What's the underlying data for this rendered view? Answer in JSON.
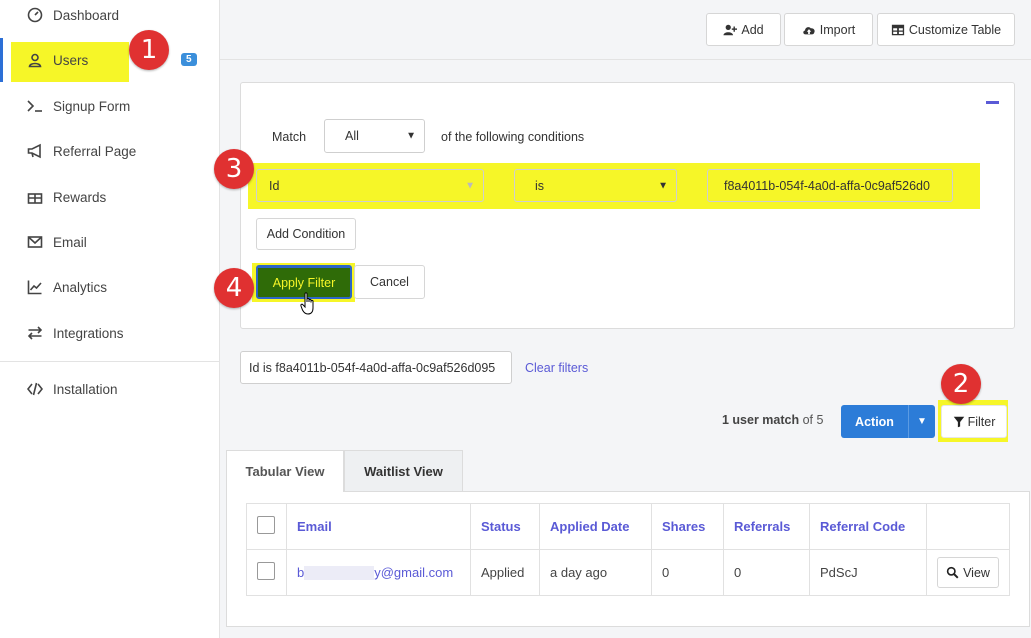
{
  "sidebar": {
    "items": [
      {
        "label": "Dashboard",
        "icon": "dashboard-icon"
      },
      {
        "label": "Users",
        "icon": "user-icon",
        "badge": "5"
      },
      {
        "label": "Signup Form",
        "icon": "terminal-icon"
      },
      {
        "label": "Referral Page",
        "icon": "megaphone-icon"
      },
      {
        "label": "Rewards",
        "icon": "gift-icon"
      },
      {
        "label": "Email",
        "icon": "envelope-icon"
      },
      {
        "label": "Analytics",
        "icon": "chart-line-icon"
      },
      {
        "label": "Integrations",
        "icon": "exchange-icon"
      },
      {
        "label": "Installation",
        "icon": "code-icon"
      }
    ]
  },
  "toolbar": {
    "add_label": "Add",
    "import_label": "Import",
    "customize_label": "Customize Table"
  },
  "filter_panel": {
    "match_label": "Match",
    "match_value": "All",
    "conditions_label": "of the following conditions",
    "field_value": "Id",
    "operator_value": "is",
    "condition_value": "f8a4011b-054f-4a0d-affa-0c9af526d0",
    "add_condition_label": "Add Condition",
    "apply_label": "Apply Filter",
    "cancel_label": "Cancel"
  },
  "active_filter": {
    "chip_text": "Id is f8a4011b-054f-4a0d-affa-0c9af526d095",
    "clear_label": "Clear filters"
  },
  "results": {
    "match_count": "1 user match",
    "match_suffix": " of 5",
    "action_label": "Action",
    "filter_label": "Filter"
  },
  "tabs": [
    {
      "label": "Tabular View"
    },
    {
      "label": "Waitlist View"
    }
  ],
  "table": {
    "headers": [
      "Email",
      "Status",
      "Applied Date",
      "Shares",
      "Referrals",
      "Referral Code"
    ],
    "rows": [
      {
        "email_prefix": "b",
        "email_suffix": "y@gmail.com",
        "status": "Applied",
        "applied_date": "a day ago",
        "shares": "0",
        "referrals": "0",
        "referral_code": "PdScJ",
        "view_label": "View"
      }
    ]
  },
  "callouts": [
    "1",
    "2",
    "3",
    "4"
  ],
  "colors": {
    "highlight": "#f6f628",
    "callout": "#e03131",
    "primary": "#2c7cd8",
    "link": "#5a5ad6",
    "apply_button": "#2f6b08"
  }
}
